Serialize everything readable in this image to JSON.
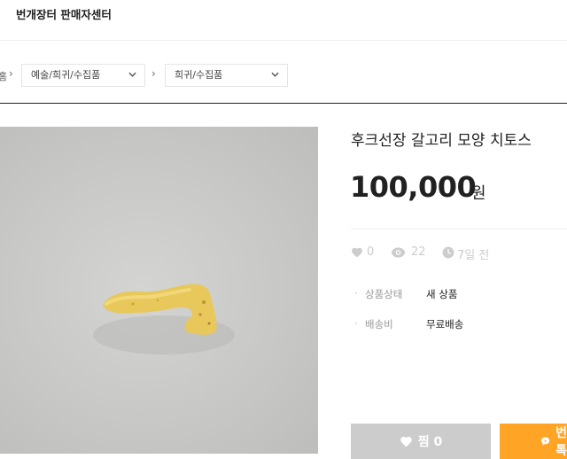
{
  "header": {
    "seller_center_label": "번개장터 판매자센터"
  },
  "breadcrumb": {
    "home_label": "홈",
    "category1": "예술/희귀/수집품",
    "category2": "희귀/수집품"
  },
  "product": {
    "title": "후크선장 갈고리 모양 치토스",
    "price": "100,000",
    "currency": "원",
    "likes": "0",
    "views": "22",
    "posted": "7일 전",
    "photo_icon": "cheetos-snack-photo"
  },
  "info": [
    {
      "label": "상품상태",
      "value": "새 상품"
    },
    {
      "label": "배송비",
      "value": "무료배송"
    }
  ],
  "actions": {
    "zzim_label": "찜 0",
    "chat_label": "번개톡"
  },
  "colors": {
    "accent": "#ffa425",
    "muted_button": "#cccccc",
    "stat_gray": "#cccccc"
  }
}
